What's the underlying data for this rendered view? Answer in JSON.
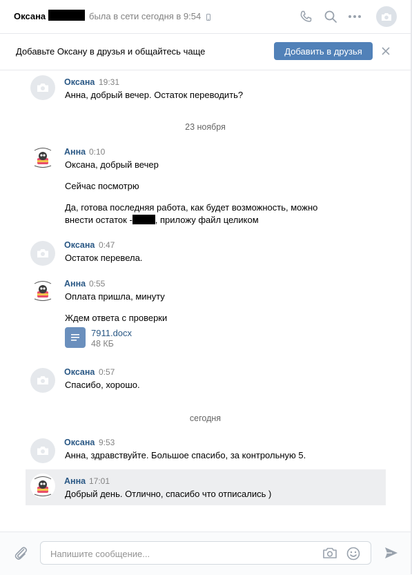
{
  "header": {
    "contact_name": "Оксана",
    "status": "была в сети сегодня в 9:54"
  },
  "banner": {
    "text": "Добавьте Оксану в друзья и общайтесь чаще",
    "add_button": "Добавить в друзья"
  },
  "colors": {
    "accent": "#5181b8",
    "link": "#2a5885",
    "muted": "#828282",
    "highlight": "#edeef0"
  },
  "messages": [
    {
      "author": "Оксана",
      "time": "19:31",
      "lines": [
        "Анна, добрый вечер. Остаток переводить?"
      ]
    },
    {
      "date_separator": "23 ноября"
    },
    {
      "author": "Анна",
      "time": "0:10",
      "lines": [
        "Оксана, добрый вечер",
        "Сейчас посмотрю",
        "Да, готова последняя работа, как будет возможность, можно",
        "внести остаток -",
        ", приложу файл целиком"
      ]
    },
    {
      "author": "Оксана",
      "time": "0:47",
      "lines": [
        "Остаток перевела."
      ]
    },
    {
      "author": "Анна",
      "time": "0:55",
      "lines": [
        "Оплата пришла, минуту",
        "Ждем ответа с проверки"
      ],
      "attachment": {
        "name": "7911.docx",
        "size": "48 КБ"
      }
    },
    {
      "author": "Оксана",
      "time": "0:57",
      "lines": [
        "Спасибо, хорошо."
      ]
    },
    {
      "date_separator": "сегодня"
    },
    {
      "author": "Оксана",
      "time": "9:53",
      "lines": [
        "Анна, здравствуйте. Большое спасибо, за контрольную 5."
      ]
    },
    {
      "author": "Анна",
      "time": "17:01",
      "lines": [
        "Добрый день. Отлично, спасибо что отписались )"
      ],
      "highlighted": true
    }
  ],
  "composer": {
    "placeholder": "Напишите сообщение..."
  }
}
